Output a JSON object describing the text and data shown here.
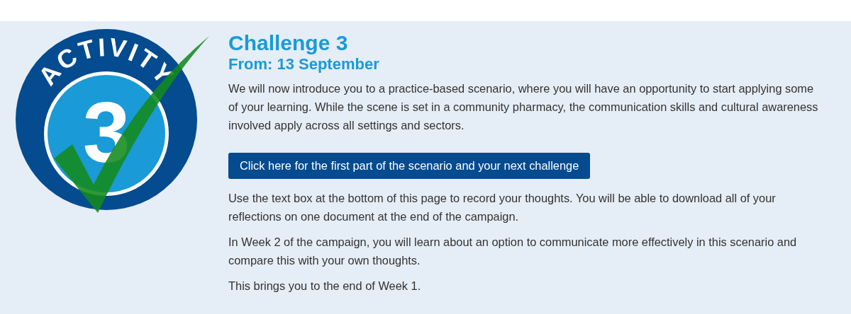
{
  "badge": {
    "arc_text": "ACTIVITY",
    "number": "3",
    "checked": true
  },
  "title": "Challenge 3",
  "subtitle": "From: 13 September",
  "intro": "We will now introduce you to a practice-based scenario, where you will have an opportunity to start applying some of your learning. While the scene is set in a community pharmacy, the communication skills and cultural awareness involved apply across all settings and sectors.",
  "button": "Click here for the first part of the scenario and your next challenge",
  "paragraphs": [
    "Use the text box at the bottom of this page to record your thoughts. You will be able to download all of your reflections on one document at the end of the campaign.",
    "In Week 2 of the campaign, you will learn about an option to communicate more effectively in this scenario and compare this with your own thoughts.",
    "This brings you to the end of Week 1."
  ]
}
